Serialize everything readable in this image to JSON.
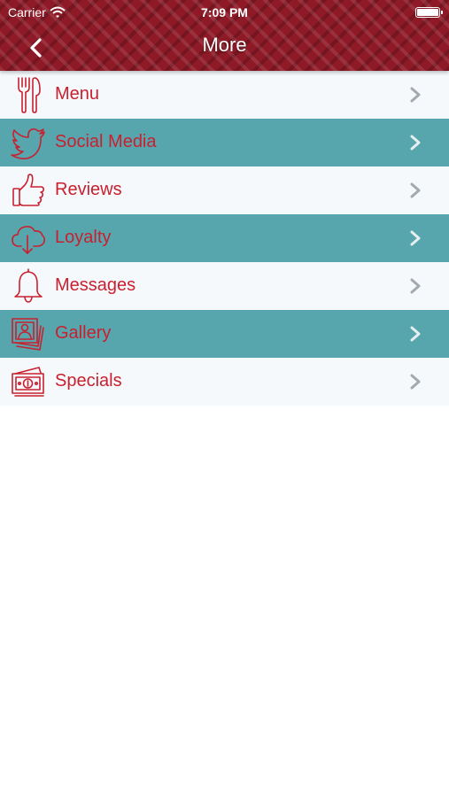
{
  "status_bar": {
    "carrier": "Carrier",
    "time": "7:09 PM"
  },
  "nav": {
    "title": "More"
  },
  "menu": [
    {
      "label": "Menu",
      "icon": "utensils-icon"
    },
    {
      "label": "Social Media",
      "icon": "twitter-bird-icon"
    },
    {
      "label": "Reviews",
      "icon": "thumbs-up-icon"
    },
    {
      "label": "Loyalty",
      "icon": "cloud-download-icon"
    },
    {
      "label": "Messages",
      "icon": "bell-icon"
    },
    {
      "label": "Gallery",
      "icon": "photo-stack-icon"
    },
    {
      "label": "Specials",
      "icon": "money-bill-icon"
    }
  ],
  "colors": {
    "header": "#8e1a27",
    "accent_text": "#c8202f",
    "teal_row": "#57a6ae",
    "light_row": "#f6f9fc",
    "chevron": "#a3a9ae"
  }
}
